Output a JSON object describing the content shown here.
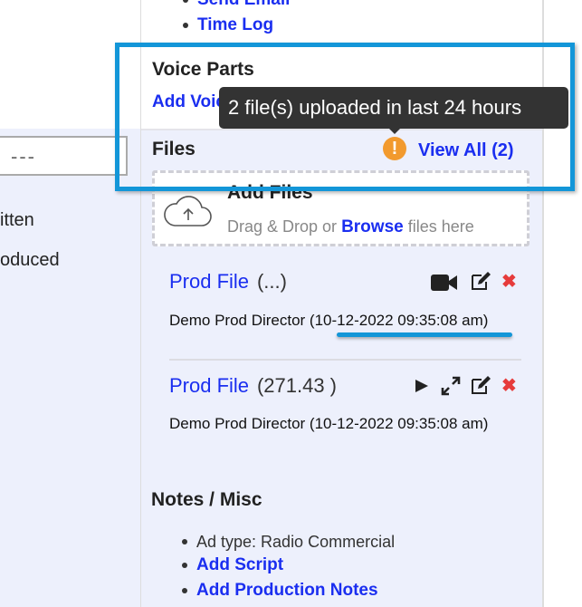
{
  "left": {
    "input_value": "---",
    "label1": "itten",
    "label2": "oduced"
  },
  "links": [
    "Send Email",
    "Time Log"
  ],
  "voice_parts": {
    "title": "Voice Parts",
    "add_label": "Add Voice"
  },
  "tooltip": "2 file(s) uploaded in last 24 hours",
  "files": {
    "title": "Files",
    "view_all": "View All (2)",
    "add_files": "Add Files",
    "drop_text_pre": "Drag & Drop or",
    "browse": "Browse",
    "drop_text_post": "files here",
    "items": [
      {
        "name": "Prod File",
        "size": "(...)",
        "meta": "Demo Prod Director (10-12-2022 09:35:08 am)",
        "media_icon": "video-camera-icon"
      },
      {
        "name": "Prod File",
        "size": "(271.43 )",
        "meta": "Demo Prod Director (10-12-2022 09:35:08 am)",
        "media_icon": "play-icon"
      }
    ]
  },
  "notes": {
    "title": "Notes / Misc",
    "ad_type": "Ad type: Radio Commercial",
    "add_script": "Add Script",
    "add_notes": "Add Production Notes"
  },
  "colors": {
    "link": "#1a2ef0",
    "highlight": "#1396d8",
    "warning": "#f29a2e",
    "delete": "#e63b3b",
    "panel": "#edf0fc"
  }
}
